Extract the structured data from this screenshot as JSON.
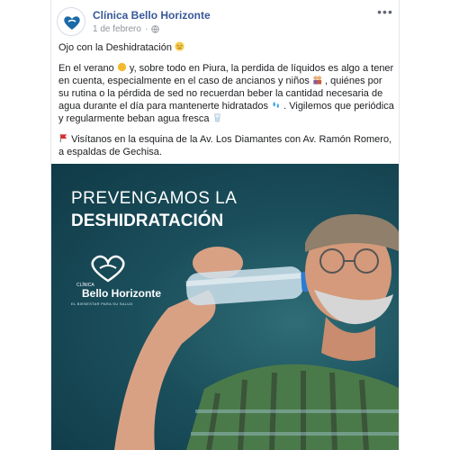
{
  "post": {
    "page_name": "Clínica Bello Horizonte",
    "date": "1 de febrero",
    "dot": "·",
    "more": "•••"
  },
  "body": {
    "line1": "Ojo con la Deshidratación",
    "para_a": "En el verano",
    "para_b": "y, sobre todo en Piura, la perdida de líquidos es algo a tener en cuenta, especialmente en el caso de ancianos y niños",
    "para_c": ", quiénes por su rutina o la pérdida de sed no recuerdan beber la cantidad necesaria de agua durante el día para mantenerte hidratados",
    "para_d": ". Vigilemos que periódica y regularmente beban agua fresca",
    "visit": "Visítanos en la esquina de la Av. Los Diamantes con Av. Ramón Romero, a espaldas de Gechisa."
  },
  "image": {
    "title_line1": "PREVENGAMOS LA",
    "title_line2": "DESHIDRATACIÓN",
    "logo_small": "CLÍNICA",
    "logo_big": "Bello Horizonte",
    "logo_tag": "EL BIENESTAR PARA SU SALUD"
  },
  "icons": [
    "globe-icon",
    "more-icon",
    "tired-face-emoji",
    "sun-emoji",
    "old-couple-emoji",
    "droplets-emoji",
    "glass-emoji",
    "red-flag-emoji",
    "heart-logo-icon"
  ],
  "colors": {
    "page_link": "#385898",
    "meta": "#90949c",
    "teal_bg": "#1b4f5c"
  }
}
